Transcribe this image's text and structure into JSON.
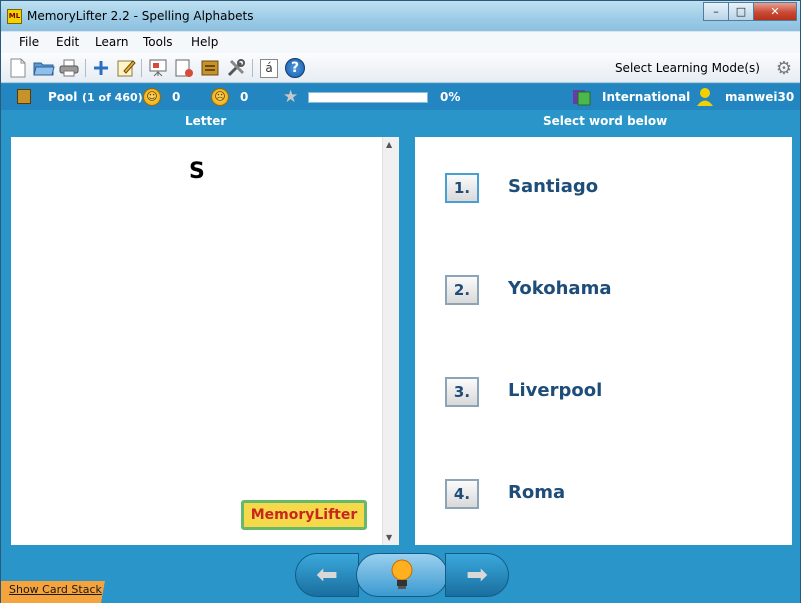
{
  "window": {
    "title": "MemoryLifter 2.2 - Spelling Alphabets",
    "app_icon_text": "ML",
    "minimize": "–",
    "maximize": "□",
    "close": "✕"
  },
  "menu": [
    "File",
    "Edit",
    "Learn",
    "Tools",
    "Help"
  ],
  "toolbar": {
    "mode_label": "Select Learning Mode(s)",
    "mode_icon": "gear-icon",
    "accent_glyph": "á",
    "help_glyph": "?"
  },
  "status": {
    "pool_label": "Pool",
    "pool_count": "(1 of 460)",
    "known_count": "0",
    "unknown_count": "0",
    "progress_text": "0%",
    "progress_value": 0,
    "dictionary": "International",
    "user": "manwei30"
  },
  "panes": {
    "left_header": "Letter",
    "right_header": "Select word below"
  },
  "question": "S",
  "logo_text": "MemoryLifter",
  "answers": [
    {
      "num": "1.",
      "text": "Santiago"
    },
    {
      "num": "2.",
      "text": "Yokohama"
    },
    {
      "num": "3.",
      "text": "Liverpool"
    },
    {
      "num": "4.",
      "text": "Roma"
    }
  ],
  "footer": {
    "show_card_stack": "Show Card Stack"
  },
  "colors": {
    "window_bg": "#2a95c9",
    "status_bg": "#2386c0",
    "answer_text": "#1d4d78",
    "logo_text": "#c8261f",
    "logo_bg": "#f5d94a"
  }
}
